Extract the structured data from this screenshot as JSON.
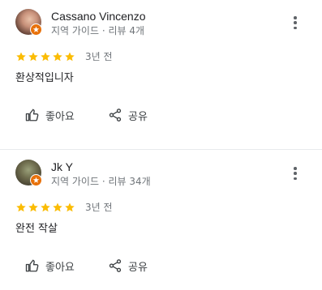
{
  "reviews": [
    {
      "name": "Cassano Vincenzo",
      "meta": "지역 가이드 · 리뷰 4개",
      "rating": 5,
      "time": "3년 전",
      "text": "환상적입니자",
      "like_label": "좋아요",
      "share_label": "공유"
    },
    {
      "name": "Jk Y",
      "meta": "지역 가이드 · 리뷰 34개",
      "rating": 5,
      "time": "3년 전",
      "text": "완전 작살",
      "like_label": "좋아요",
      "share_label": "공유"
    }
  ],
  "colors": {
    "star": "#fbbc04",
    "badge": "#e8710a",
    "muted": "#70757a",
    "text": "#202124"
  },
  "icons": {
    "star": "star-icon",
    "badge": "local-guide-badge-icon",
    "more": "more-vert-icon",
    "like": "thumb-up-icon",
    "share": "share-icon"
  }
}
